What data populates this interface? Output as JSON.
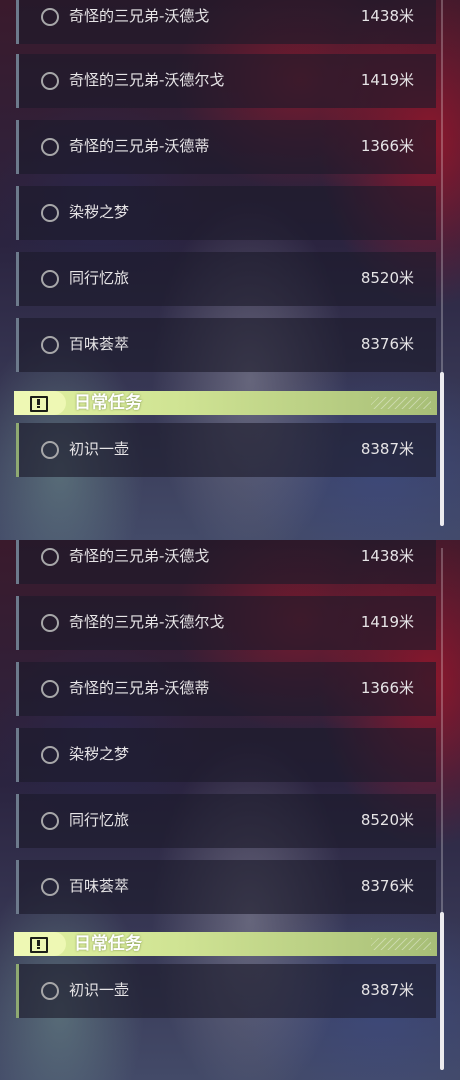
{
  "top_list": {
    "items": [
      {
        "name": "奇怪的三兄弟-沃德戈",
        "distance": "1438米"
      },
      {
        "name": "奇怪的三兄弟-沃德尔戈",
        "distance": "1419米"
      },
      {
        "name": "奇怪的三兄弟-沃德蒂",
        "distance": "1366米"
      },
      {
        "name": "染秽之梦",
        "distance": ""
      },
      {
        "name": "同行忆旅",
        "distance": "8520米"
      },
      {
        "name": "百味荟萃",
        "distance": "8376米"
      }
    ],
    "section": {
      "title": "日常任务",
      "icon": "exclamation-icon"
    },
    "daily_items": [
      {
        "name": "初识一壶",
        "distance": "8387米"
      }
    ]
  },
  "bottom_list": {
    "items": [
      {
        "name": "奇怪的三兄弟-沃德戈",
        "distance": "1438米"
      },
      {
        "name": "奇怪的三兄弟-沃德尔戈",
        "distance": "1419米"
      },
      {
        "name": "奇怪的三兄弟-沃德蒂",
        "distance": "1366米"
      },
      {
        "name": "染秽之梦",
        "distance": ""
      },
      {
        "name": "同行忆旅",
        "distance": "8520米"
      },
      {
        "name": "百味荟萃",
        "distance": "8376米"
      }
    ],
    "section": {
      "title": "日常任务",
      "icon": "exclamation-icon"
    },
    "daily_items": [
      {
        "name": "初识一壶",
        "distance": "8387米"
      }
    ]
  },
  "colors": {
    "daily_accent": "#cfe393",
    "quest_border": "#6d7a8c",
    "text": "#e6e4e6"
  }
}
